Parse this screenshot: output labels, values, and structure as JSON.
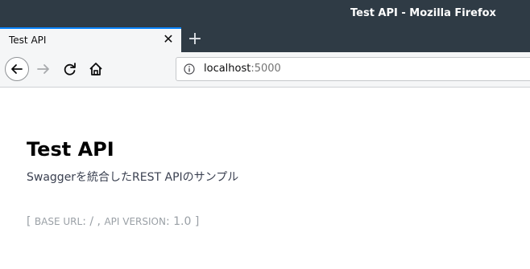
{
  "window": {
    "title": "Test API - Mozilla Firefox"
  },
  "tabs": [
    {
      "label": "Test API",
      "close_glyph": "✕"
    }
  ],
  "newtab_glyph": "+",
  "navbar": {
    "back_icon": "back-arrow-icon",
    "forward_icon": "forward-arrow-icon",
    "reload_icon": "reload-icon",
    "home_icon": "home-icon"
  },
  "urlbar": {
    "host": "localhost",
    "port": ":5000",
    "info_icon": "info-icon"
  },
  "page": {
    "title": "Test API",
    "description": "Swaggerを統合したREST APIのサンプル",
    "base_url": {
      "open": "[ ",
      "label": "BASE URL",
      "colon1": ": ",
      "value": "/",
      "sep": " , ",
      "version_label": "API VERSION",
      "colon2": ": ",
      "version": "1.0",
      "close": " ]"
    }
  },
  "colors": {
    "titlebar": "#2f3b45",
    "tab_accent": "#0a84ff",
    "toolbar": "#f5f6f7"
  }
}
